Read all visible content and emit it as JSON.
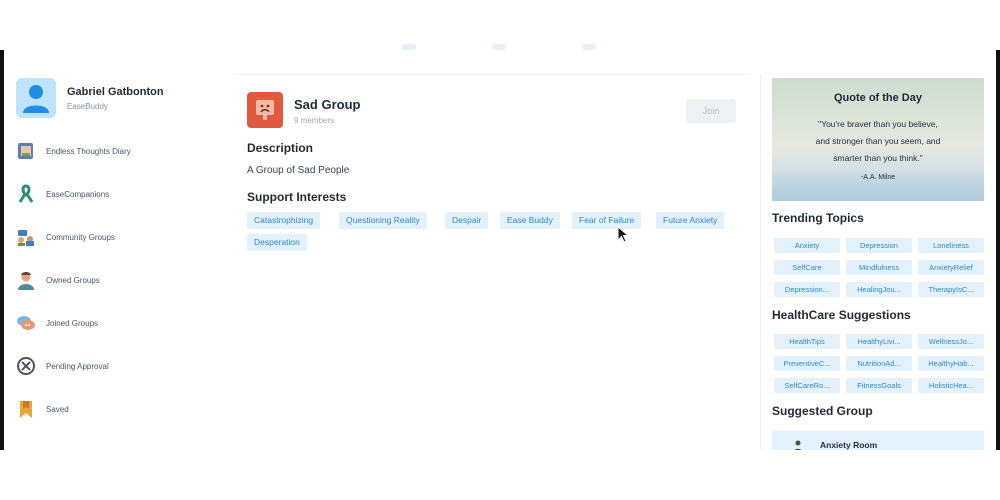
{
  "profile": {
    "name": "Gabriel Gatbonton",
    "subtitle": "EaseBuddy"
  },
  "nav": [
    {
      "label": "Endless Thoughts Diary",
      "icon": "diary-icon"
    },
    {
      "label": "EaseCompanions",
      "icon": "ribbon-icon"
    },
    {
      "label": "Community Groups",
      "icon": "community-icon"
    },
    {
      "label": "Owned Groups",
      "icon": "owner-icon"
    },
    {
      "label": "Joined Groups",
      "icon": "chat-bubbles-icon"
    },
    {
      "label": "Pending Approval",
      "icon": "pending-icon"
    },
    {
      "label": "Saved",
      "icon": "bookmark-icon"
    }
  ],
  "group": {
    "name": "Sad Group",
    "members": "9 members",
    "join_label": "Join",
    "description_title": "Description",
    "description": "A Group of Sad People",
    "interests_title": "Support Interests",
    "interests": [
      "Catastrophizing",
      "Questioning Reality",
      "Despair",
      "Ease Buddy",
      "Fear of Failure",
      "Future Anxiety",
      "Desperation"
    ]
  },
  "quote": {
    "title": "Quote of the Day",
    "line1": "\"You're braver than you believe,",
    "line2": "and stronger than you seem, and",
    "line3": "smarter than you think.\"",
    "author": "-A.A. Milne"
  },
  "trending": {
    "title": "Trending Topics",
    "items": [
      "Anxiety",
      "Depression",
      "Loneliness",
      "SelfCare",
      "Mindfulness",
      "AnxietyRelief",
      "Depression...",
      "HealingJou...",
      "TherapyIsC..."
    ]
  },
  "healthcare": {
    "title": "HealthCare Suggestions",
    "items": [
      "HealthTips",
      "HealthyLivi...",
      "WellnessJo...",
      "PreventiveC...",
      "NutritionAd...",
      "HealthyHab...",
      "SelfCareRo...",
      "FitnessGoals",
      "HolisticHea..."
    ]
  },
  "suggested": {
    "title": "Suggested Group",
    "item": "Anxiety Room"
  },
  "colors": {
    "accent": "#2f88c6",
    "chip_bg": "#e3f1fc",
    "group_thumb": "#e05a40",
    "avatar_bg": "#bfe3fb"
  }
}
